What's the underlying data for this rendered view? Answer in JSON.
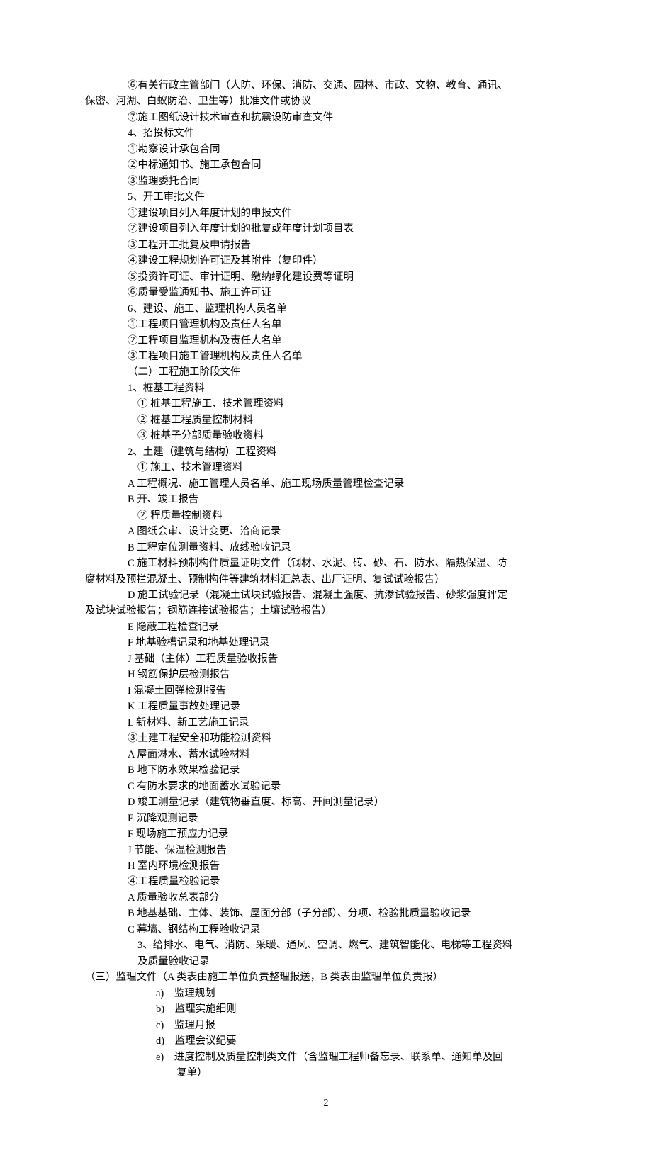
{
  "lines": [
    {
      "cls": "indent-1",
      "t": "⑥有关行政主管部门（人防、环保、消防、交通、园林、市政、文物、教育、通讯、"
    },
    {
      "cls": "no-indent",
      "t": "保密、河湖、白蚁防治、卫生等）批准文件或协议"
    },
    {
      "cls": "indent-1",
      "t": "⑦施工图纸设计技术审查和抗震设防审查文件"
    },
    {
      "cls": "indent-1",
      "t": "4、招投标文件"
    },
    {
      "cls": "indent-1",
      "t": "①勘察设计承包合同"
    },
    {
      "cls": "indent-1",
      "t": "②中标通知书、施工承包合同"
    },
    {
      "cls": "indent-1",
      "t": "③监理委托合同"
    },
    {
      "cls": "indent-1",
      "t": "5、开工审批文件"
    },
    {
      "cls": "indent-1",
      "t": "①建设项目列入年度计划的申报文件"
    },
    {
      "cls": "indent-1",
      "t": "②建设项目列入年度计划的批复或年度计划项目表"
    },
    {
      "cls": "indent-1",
      "t": "③工程开工批复及申请报告"
    },
    {
      "cls": "indent-1",
      "t": "④建设工程规划许可证及其附件（复印件）"
    },
    {
      "cls": "indent-1",
      "t": "⑤投资许可证、审计证明、缴纳绿化建设费等证明"
    },
    {
      "cls": "indent-1",
      "t": "⑥质量受监通知书、施工许可证"
    },
    {
      "cls": "indent-1",
      "t": "6、建设、施工、监理机构人员名单"
    },
    {
      "cls": "indent-1",
      "t": "①工程项目管理机构及责任人名单"
    },
    {
      "cls": "indent-1",
      "t": "②工程项目监理机构及责任人名单"
    },
    {
      "cls": "indent-1",
      "t": "③工程项目施工管理机构及责任人名单"
    },
    {
      "cls": "indent-1",
      "t": "（二）工程施工阶段文件"
    },
    {
      "cls": "indent-1",
      "t": "1、桩基工程资料"
    },
    {
      "cls": "indent-2",
      "t": "① 桩基工程施工、技术管理资料"
    },
    {
      "cls": "indent-2",
      "t": "② 桩基工程质量控制材料"
    },
    {
      "cls": "indent-2",
      "t": "③ 桩基子分部质量验收资料"
    },
    {
      "cls": "indent-1",
      "t": "2、土建（建筑与结构）工程资料"
    },
    {
      "cls": "indent-2",
      "t": "① 施工、技术管理资料"
    },
    {
      "cls": "indent-1",
      "t": "A 工程概况、施工管理人员名单、施工现场质量管理检查记录"
    },
    {
      "cls": "indent-1",
      "t": "B 开、竣工报告"
    },
    {
      "cls": "indent-2",
      "t": "② 程质量控制资料"
    },
    {
      "cls": "indent-1",
      "t": "A 图纸会审、设计变更、洽商记录"
    },
    {
      "cls": "indent-1",
      "t": "B 工程定位测量资料、放线验收记录"
    },
    {
      "cls": "indent-1",
      "t": "C 施工材料预制构件质量证明文件（钢材、水泥、砖、砂、石、防水、隔热保温、防"
    },
    {
      "cls": "no-indent",
      "t": "腐材料及预拦混凝土、预制构件等建筑材料汇总表、出厂证明、复试试验报告）"
    },
    {
      "cls": "indent-1",
      "t": "D 施工试验记录（混凝土试块试验报告、混凝土强度、抗渗试验报告、砂浆强度评定"
    },
    {
      "cls": "no-indent",
      "t": "及试块试验报告；钢筋连接试验报告；土壤试验报告）"
    },
    {
      "cls": "indent-1",
      "t": "E 隐蔽工程检查记录"
    },
    {
      "cls": "indent-1",
      "t": "F 地基验槽记录和地基处理记录"
    },
    {
      "cls": "indent-1",
      "t": "J 基础（主体）工程质量验收报告"
    },
    {
      "cls": "indent-1",
      "t": "H 钢筋保护层检测报告"
    },
    {
      "cls": "indent-1",
      "t": "I 混凝土回弹检测报告"
    },
    {
      "cls": "indent-1",
      "t": "K 工程质量事故处理记录"
    },
    {
      "cls": "indent-1",
      "t": "L 新材料、新工艺施工记录"
    },
    {
      "cls": "indent-1",
      "t": "③土建工程安全和功能检测资料"
    },
    {
      "cls": "indent-1",
      "t": "A 屋面淋水、蓄水试验材料"
    },
    {
      "cls": "indent-1",
      "t": "B 地下防水效果检验记录"
    },
    {
      "cls": "indent-1",
      "t": "C 有防水要求的地面蓄水试验记录"
    },
    {
      "cls": "indent-1",
      "t": "D 竣工测量记录（建筑物垂直度、标高、开间测量记录）"
    },
    {
      "cls": "indent-1",
      "t": "E 沉降观测记录"
    },
    {
      "cls": "indent-1",
      "t": "F 现场施工预应力记录"
    },
    {
      "cls": "indent-1",
      "t": "J 节能、保温检测报告"
    },
    {
      "cls": "indent-1",
      "t": "H 室内环境检测报告"
    },
    {
      "cls": "indent-1",
      "t": "④工程质量检验记录"
    },
    {
      "cls": "indent-1",
      "t": "A 质量验收总表部分"
    },
    {
      "cls": "indent-1",
      "t": "B 地基基础、主体、装饰、屋面分部（子分部）、分项、检验批质量验收记录"
    },
    {
      "cls": "indent-1",
      "t": "C 幕墙、钢结构工程验收记录"
    },
    {
      "cls": "indent-2",
      "t": "3、给排水、电气、消防、采暖、通风、空调、燃气、建筑智能化、电梯等工程资料"
    },
    {
      "cls": "indent-2",
      "t": "及质量验收记录"
    },
    {
      "cls": "no-indent",
      "t": "（三）监理文件（A 类表由施工单位负责整理报送，B 类表由监理单位负责报）"
    },
    {
      "cls": "indent-3",
      "t": "a)　监理规划"
    },
    {
      "cls": "indent-3",
      "t": "b)　监理实施细则"
    },
    {
      "cls": "indent-3",
      "t": "c)　监理月报"
    },
    {
      "cls": "indent-3",
      "t": "d)　监理会议纪要"
    },
    {
      "cls": "indent-3",
      "t": "e)　进度控制及质量控制类文件（含监理工程师备忘录、联系单、通知单及回"
    },
    {
      "cls": "indent-3",
      "t": "　　复单）"
    }
  ],
  "pageNumber": "2"
}
